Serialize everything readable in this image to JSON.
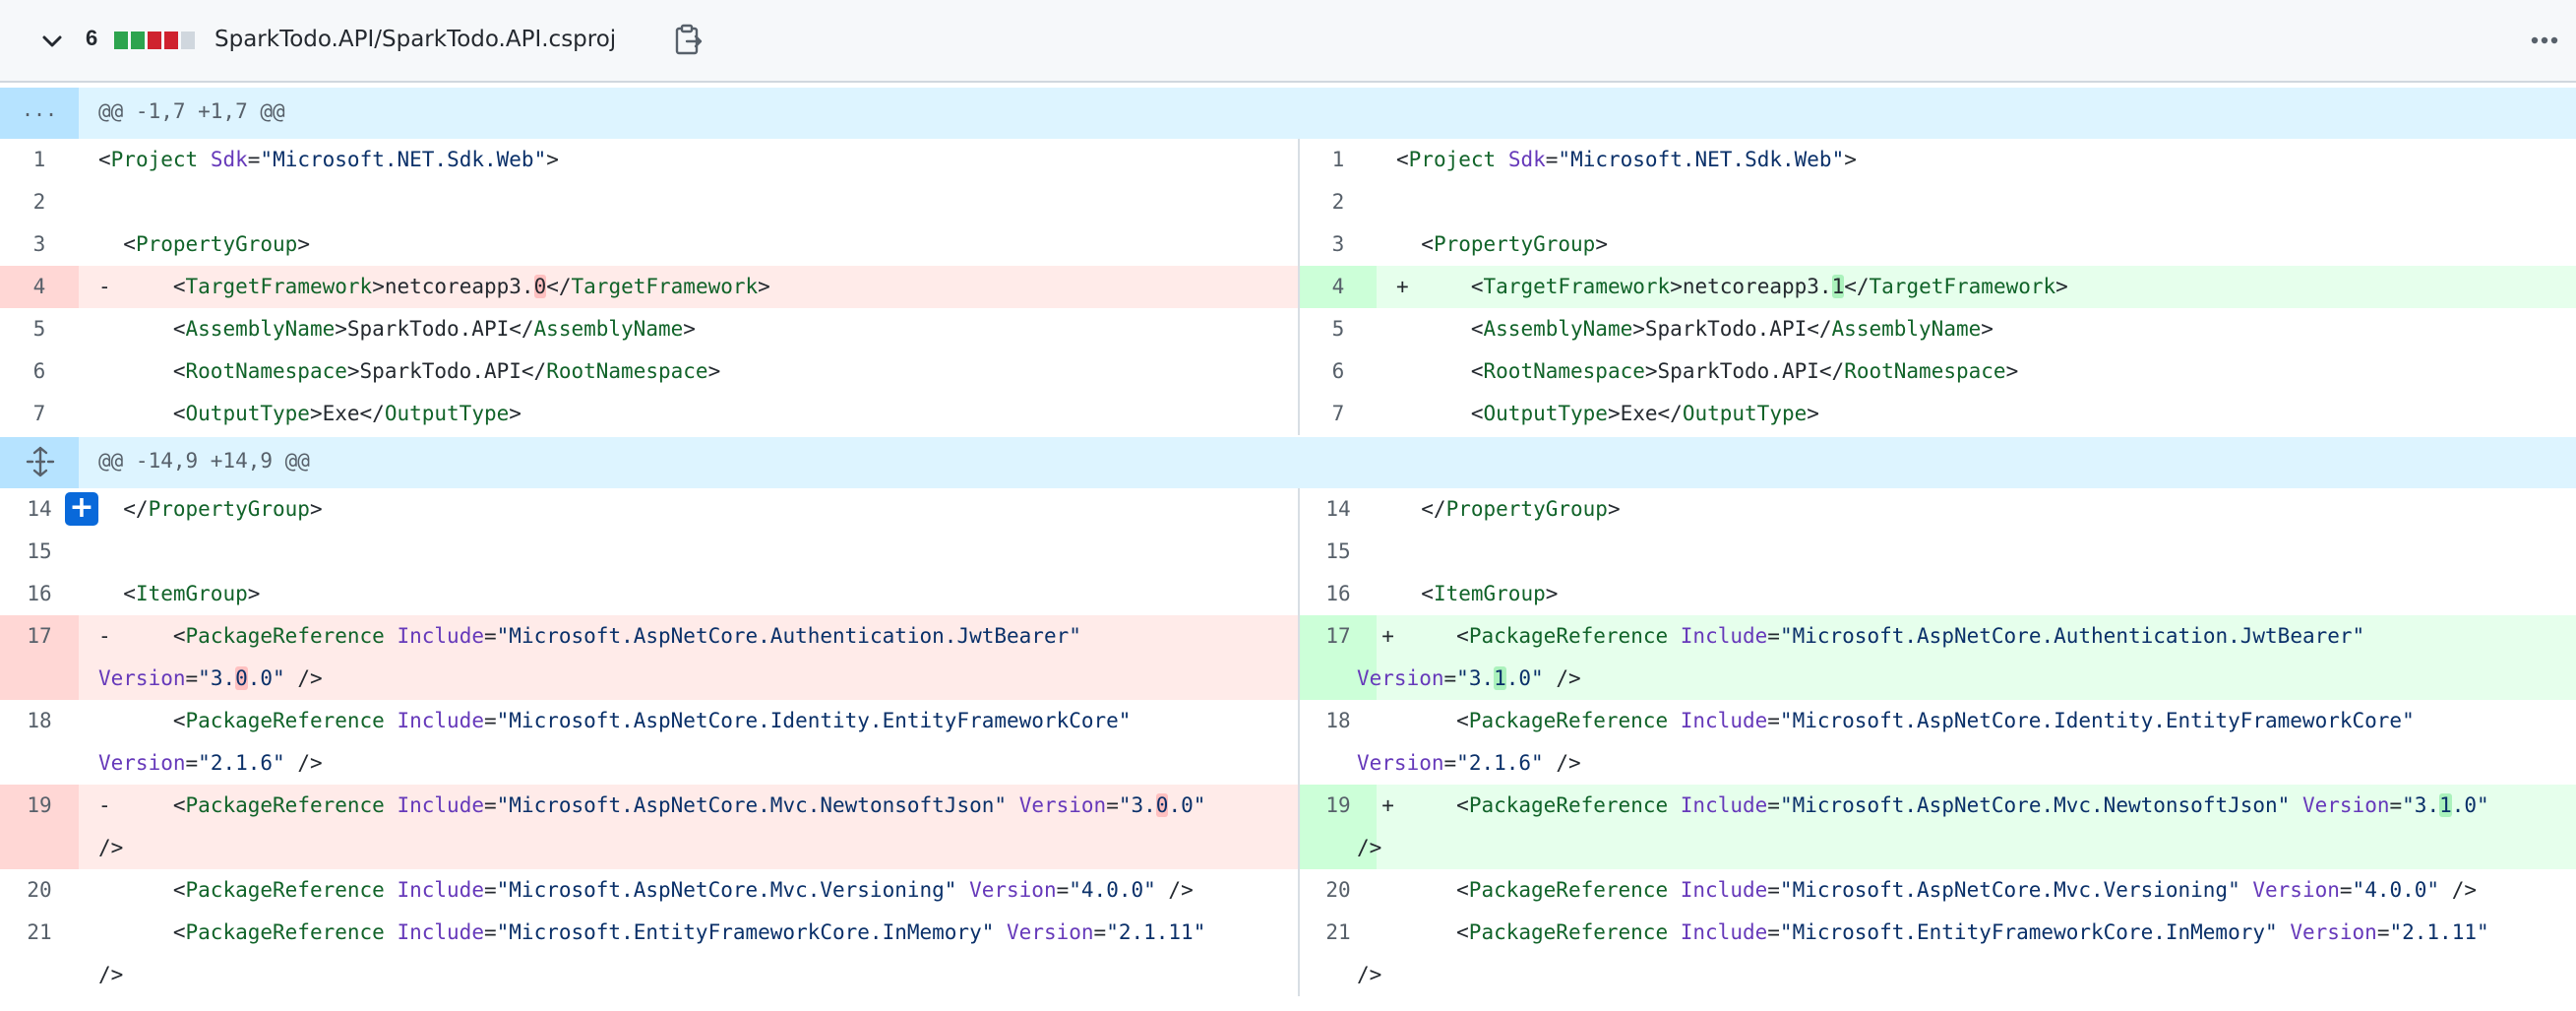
{
  "header": {
    "changes_count": "6",
    "diffstat": [
      "#2da44e",
      "#2da44e",
      "#cf222e",
      "#cf222e",
      "#d0d7de"
    ],
    "file_path": "SparkTodo.API/SparkTodo.API.csproj"
  },
  "hunks": [
    {
      "expander": "...",
      "header": "@@ -1,7 +1,7 @@"
    },
    {
      "expander": "expand-icon",
      "header": "@@ -14,9 +14,9 @@"
    }
  ],
  "lines": {
    "l1": {
      "num": "1",
      "t1": "<",
      "t2": "Project",
      "t3": " ",
      "t4": "Sdk",
      "t5": "=",
      "t6": "\"Microsoft.NET.Sdk.Web\"",
      "t7": ">"
    },
    "l2": {
      "num": "2"
    },
    "l3": {
      "num": "3",
      "t1": "  <",
      "t2": "PropertyGroup",
      "t3": ">"
    },
    "l4": {
      "num": "4",
      "marker_old": "-",
      "marker_new": "+",
      "pre": "    <",
      "tag": "TargetFramework",
      "mid_a": ">netcoreapp3.",
      "old_ch": "0",
      "new_ch": "1",
      "mid_b": "</",
      "tag2": "TargetFramework",
      "end": ">"
    },
    "l5": {
      "num": "5",
      "pre": "    <",
      "tag": "AssemblyName",
      "mid": ">SparkTodo.API</",
      "tag2": "AssemblyName",
      "end": ">"
    },
    "l6": {
      "num": "6",
      "pre": "    <",
      "tag": "RootNamespace",
      "mid": ">SparkTodo.API</",
      "tag2": "RootNamespace",
      "end": ">"
    },
    "l7": {
      "num": "7",
      "pre": "    <",
      "tag": "OutputType",
      "mid": ">Exe</",
      "tag2": "OutputType",
      "end": ">"
    },
    "l14": {
      "num": "14",
      "pre": "  </",
      "tag": "PropertyGroup",
      "end": ">"
    },
    "l15": {
      "num": "15"
    },
    "l16": {
      "num": "16",
      "pre": "  <",
      "tag": "ItemGroup",
      "end": ">"
    },
    "l17": {
      "num": "17",
      "marker_old": "-",
      "marker_new": "+",
      "pre": "    <",
      "tag": "PackageReference",
      "attr": "Include",
      "eq": "=",
      "val": "\"Microsoft.AspNetCore.Authentication.JwtBearer\"",
      "attr2": "Version",
      "eq2": "=",
      "v_a": "\"3.",
      "old_ch": "0",
      "new_ch": "1",
      "v_b": ".0\"",
      "end": " />"
    },
    "l18": {
      "num": "18",
      "pre": "    <",
      "tag": "PackageReference",
      "attr": "Include",
      "eq": "=",
      "val": "\"Microsoft.AspNetCore.Identity.EntityFrameworkCore\"",
      "attr2": "Version",
      "eq2": "=",
      "val2": "\"2.1.6\"",
      "end": " />"
    },
    "l19": {
      "num": "19",
      "marker_old": "-",
      "marker_new": "+",
      "pre": "    <",
      "tag": "PackageReference",
      "attr": "Include",
      "eq": "=",
      "val": "\"Microsoft.AspNetCore.Mvc.NewtonsoftJson\"",
      "attr2": "Version",
      "eq2": "=",
      "v_a": "\"3.",
      "old_ch": "0",
      "new_ch": "1",
      "v_b": ".0\"",
      "end": "/>"
    },
    "l20": {
      "num": "20",
      "pre": "    <",
      "tag": "PackageReference",
      "attr": "Include",
      "eq": "=",
      "val": "\"Microsoft.AspNetCore.Mvc.Versioning\"",
      "attr2": "Version",
      "eq2": "=",
      "val2": "\"4.0.0\"",
      "end": " />"
    },
    "l21": {
      "num": "21",
      "pre": "    <",
      "tag": "PackageReference",
      "attr": "Include",
      "eq": "=",
      "val": "\"Microsoft.EntityFrameworkCore.InMemory\"",
      "attr2": "Version",
      "eq2": "=",
      "val2": "\"2.1.11\"",
      "end": "/>"
    }
  }
}
